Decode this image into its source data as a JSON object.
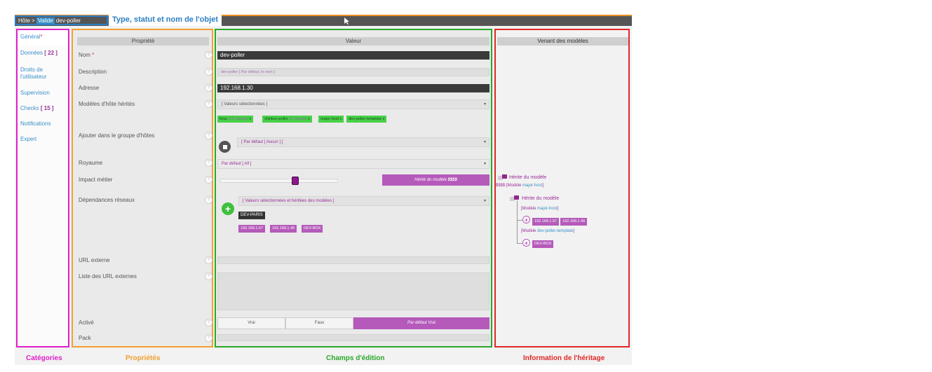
{
  "header": {
    "breadcrumb_host": "Hôte >",
    "breadcrumb_status": "Valide",
    "breadcrumb_name": "dev-poller",
    "annotation": "Type, statut et nom de l'objet"
  },
  "categories": {
    "items": [
      {
        "label": "Général",
        "marker": "*"
      },
      {
        "label": "Données",
        "count": "[ 22 ]"
      },
      {
        "label": "Droits de",
        "label2": "l'utilisateur"
      },
      {
        "label": "Supervision"
      },
      {
        "label": "Checks",
        "count": "[ 15 ]"
      },
      {
        "label": "Notifications"
      },
      {
        "label": "Expert"
      }
    ]
  },
  "columns": {
    "property": "Propriété",
    "value": "Valeur",
    "inherited": "Venant des modèles"
  },
  "properties": [
    {
      "label": "Nom",
      "required": "*"
    },
    {
      "label": "Description"
    },
    {
      "label": "Adresse"
    },
    {
      "label": "Modèles d'hôte hérités"
    },
    {
      "label": "Ajouter dans le groupe d'hôtes"
    },
    {
      "label": "Royaume"
    },
    {
      "label": "Impact métier"
    },
    {
      "label": "Dépendances réseaux"
    },
    {
      "label": "URL externe"
    },
    {
      "label": "Liste des URL externes"
    },
    {
      "label": "Activé"
    },
    {
      "label": "Pack"
    }
  ],
  "help_icon": "?",
  "values": {
    "name": "dev-poller",
    "description_placeholder": "dev-poller [ Par défaut, le nom ]",
    "address": "192.168.1.30",
    "templates_select": "[ Valeurs sélectionnées ]",
    "templates": [
      {
        "name": "linux",
        "sub": "[13 checks]"
      },
      {
        "name": "shinken-poller",
        "sub": "[2 checks]"
      },
      {
        "name": "major-host",
        "sub": ""
      },
      {
        "name": "dev-poller-template",
        "sub": ""
      }
    ],
    "tag_remove": "x",
    "hostgroup_select": "[ Par défaut [ Aucun ] ]",
    "realm_select": "Par défaut [ All ]",
    "impact_inherited": "Hérité du modèle",
    "impact_value": "$$$$",
    "impact_slider_fraction": 0.65,
    "dependencies_select": "[ Valeurs sélectionnées et héritées des modèles ]",
    "dependency_direct": "DEV-PARIS",
    "dependency_inherited": [
      "192.168.1.57",
      "192.168.1.49",
      "DEV-BOX"
    ],
    "enabled_options": [
      "Vrai",
      "Faux"
    ],
    "enabled_default_prefix": "Par défaut",
    "enabled_default_value": "Vrai",
    "caret": "▾",
    "plus": "+"
  },
  "heritage": {
    "label": "Hérite du modèle",
    "impact_prefix": "$$$$ [Modèle",
    "impact_template": "major-host",
    "impact_suffix": "]",
    "dep_label": "Hérite du modèle",
    "group1_prefix": "[Modèle",
    "group1_template": "major-host",
    "group1_suffix": "]",
    "group1_tags": [
      "192.168.1.57",
      "192.168.1.49"
    ],
    "group2_prefix": "[Modèle",
    "group2_template": "dev-poller-template",
    "group2_suffix": "]",
    "group2_tags": [
      "DEV-BOX"
    ]
  },
  "legend": {
    "categories": "Catégories",
    "properties": "Propriétés",
    "fields": "Champs d'édition",
    "heritage": "Information de l'héritage"
  },
  "colors": {
    "categories": "#e020c8",
    "properties": "#f0a030",
    "fields": "#2aa82a",
    "heritage": "#e02828",
    "annotation": "#2b7fc4",
    "purple": "#b55aba"
  }
}
